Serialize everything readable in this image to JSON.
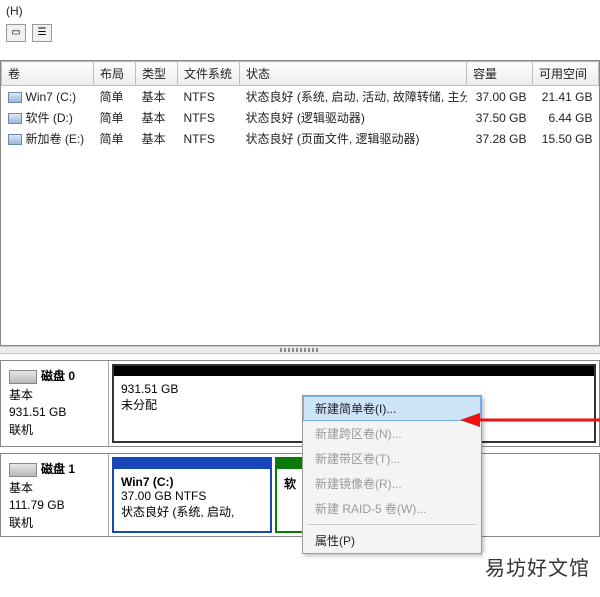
{
  "header": {
    "drive_letter": "(H)"
  },
  "columns": {
    "vol": "卷",
    "layout": "布局",
    "type": "类型",
    "fs": "文件系统",
    "status": "状态",
    "capacity": "容量",
    "free": "可用空间"
  },
  "volumes": [
    {
      "name": "Win7 (C:)",
      "layout": "简单",
      "type": "基本",
      "fs": "NTFS",
      "status": "状态良好 (系统, 启动, 活动, 故障转储, 主分区)",
      "capacity": "37.00 GB",
      "free": "21.41 GB"
    },
    {
      "name": "软件 (D:)",
      "layout": "简单",
      "type": "基本",
      "fs": "NTFS",
      "status": "状态良好 (逻辑驱动器)",
      "capacity": "37.50 GB",
      "free": "6.44 GB"
    },
    {
      "name": "新加卷 (E:)",
      "layout": "简单",
      "type": "基本",
      "fs": "NTFS",
      "status": "状态良好 (页面文件, 逻辑驱动器)",
      "capacity": "37.28 GB",
      "free": "15.50 GB"
    }
  ],
  "disk0": {
    "title": "磁盘 0",
    "type": "基本",
    "size": "931.51 GB",
    "state": "联机",
    "part_size": "931.51 GB",
    "part_label": "未分配"
  },
  "disk1": {
    "title": "磁盘 1",
    "type": "基本",
    "size": "111.79 GB",
    "state": "联机",
    "p1_name": "Win7  (C:)",
    "p1_line2": "37.00 GB NTFS",
    "p1_line3": "状态良好 (系统, 启动,",
    "p2_name": "软"
  },
  "menu": {
    "simple": "新建简单卷(I)...",
    "span": "新建跨区卷(N)...",
    "stripe": "新建带区卷(T)...",
    "mirror": "新建镜像卷(R)...",
    "raid5": "新建 RAID-5 卷(W)...",
    "props": "属性(P)"
  },
  "watermark": "易坊好文馆"
}
